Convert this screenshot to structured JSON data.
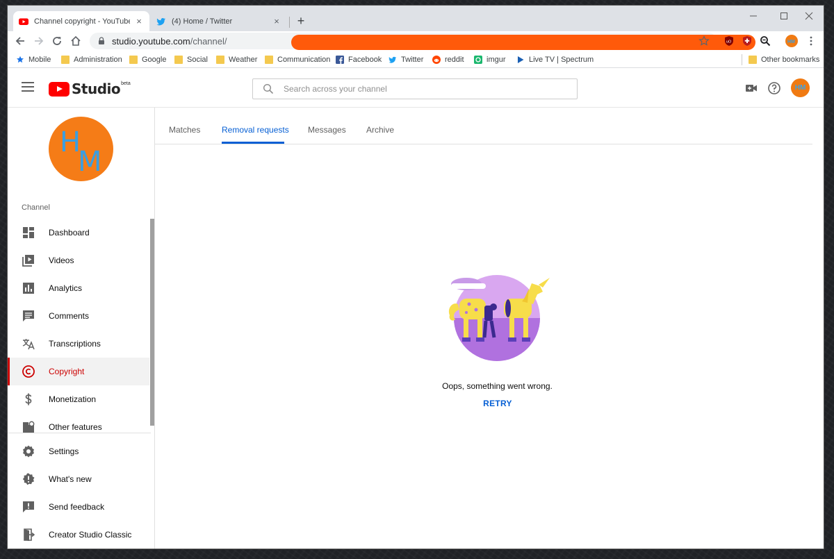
{
  "browser": {
    "tabs": [
      {
        "title": "Channel copyright - YouTube Stu",
        "active": true
      },
      {
        "title": "(4) Home / Twitter",
        "active": false
      }
    ],
    "new_tab": "+",
    "close_glyph": "×",
    "url_host": "studio.youtube.com",
    "url_path": "/channel/",
    "bookmarks": [
      "Mobile",
      "Administration",
      "Google",
      "Social",
      "Weather",
      "Communication",
      "Facebook",
      "Twitter",
      "reddit",
      "imgur",
      "Live TV | Spectrum"
    ],
    "other_bookmarks": "Other bookmarks"
  },
  "header": {
    "logo_text": "Studio",
    "beta": "beta",
    "search_placeholder": "Search across your channel",
    "avatar_initials": "HM"
  },
  "sidebar": {
    "avatar_h": "H",
    "avatar_m": "M",
    "section": "Channel",
    "items": [
      {
        "label": "Dashboard",
        "icon": "dashboard-icon"
      },
      {
        "label": "Videos",
        "icon": "videos-icon"
      },
      {
        "label": "Analytics",
        "icon": "analytics-icon"
      },
      {
        "label": "Comments",
        "icon": "comments-icon"
      },
      {
        "label": "Transcriptions",
        "icon": "transcriptions-icon"
      },
      {
        "label": "Copyright",
        "icon": "copyright-icon",
        "active": true
      },
      {
        "label": "Monetization",
        "icon": "monetization-icon"
      },
      {
        "label": "Other features",
        "icon": "other-features-icon"
      },
      {
        "label": "Settings",
        "icon": "settings-icon"
      },
      {
        "label": "What's new",
        "icon": "whats-new-icon"
      },
      {
        "label": "Send feedback",
        "icon": "feedback-icon"
      },
      {
        "label": "Creator Studio Classic",
        "icon": "creator-studio-classic-icon"
      }
    ]
  },
  "main": {
    "tabs": [
      {
        "label": "Matches"
      },
      {
        "label": "Removal requests",
        "active": true
      },
      {
        "label": "Messages"
      },
      {
        "label": "Archive"
      }
    ],
    "error_message": "Oops, something went wrong.",
    "retry_label": "RETRY"
  },
  "colors": {
    "accent_blue": "#065fd4",
    "active_red": "#cc0000",
    "redaction": "#ff5a0a"
  }
}
